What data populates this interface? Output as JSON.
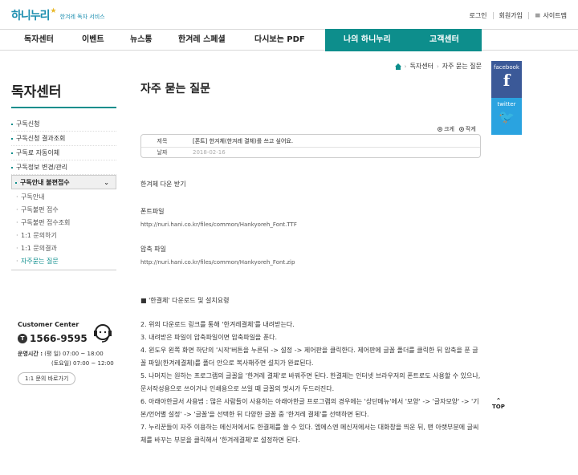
{
  "header": {
    "logo_text": "하니누리",
    "logo_sub": "한겨레 독자 서비스",
    "util": {
      "login": "로그인",
      "join": "회원가입",
      "sitemap": "사이트맵"
    }
  },
  "nav": {
    "items": [
      "독자센터",
      "이벤트",
      "뉴스통",
      "한겨레 스페셜",
      "다시보는 PDF"
    ],
    "highlight": [
      "나의 하니누리",
      "고객센터"
    ]
  },
  "breadcrumb": [
    "독자센터",
    "자주 묻는 질문"
  ],
  "social": {
    "facebook": "facebook",
    "twitter": "twitter"
  },
  "sidebar": {
    "title": "독자센터",
    "items": [
      "구독신청",
      "구독신청 결과조회",
      "구독료 자동이체",
      "구독정보 변경/관리"
    ],
    "open_item": "구독안내 불편접수",
    "sub_items": [
      "구독안내",
      "구독불편 접수",
      "구독불편 접수조회",
      "1:1 문의하기",
      "1:1 문의결과",
      "자주묻는 질문"
    ]
  },
  "customer_center": {
    "title": "Customer Center",
    "phone": "1566-9595",
    "hours_label": "운영시간 :",
    "hours_weekday": "(평    일) 07:00 ~ 18:00",
    "hours_sat": "(토요일) 07:00 ~ 12:00",
    "button": "1:1 문의 바로가기"
  },
  "article": {
    "page_title": "자주 묻는 질문",
    "font_bigger": "크게",
    "font_smaller": "작게",
    "subject_label": "제목",
    "subject": "[폰트] 한겨체(한겨레 결체)를 쓰고 싶어요.",
    "date_label": "날짜",
    "date": "2018-02-16",
    "lines": {
      "l1": "한겨체 다운 받기",
      "l2": "폰트파일",
      "l3": "http://nuri.hani.co.kr/files/common/Hankyoreh_Font.TTF",
      "l4": "압축 파일",
      "l5": "http://nuri.hani.co.kr/files/common/Hankyoreh_Font.zip",
      "l6": "■ '한결체' 다운로드 및 설치요령",
      "l7": "2. 위의 다운로드 링크를 통해 '한겨레결체'를 내려받는다.",
      "l8": "3. 내려받은 파일이 압축파일이면 압축파일을 푼다.",
      "l9": "4. 윈도우 왼쪽 화면 하단의 '시작'버튼을 누른뒤 -> 설정 -> 제어판을 클릭한다. 제어판에 글꼴 폴더를 클릭한 뒤 압축을 푼 글꼴 파일(한겨레결체)를 폴더 안으로 복사해주면 설치가 완료된다.",
      "l10": "5. 나머지는 원하는 프로그램의 글꼴을 '한겨레 결체'로 바꿔주면 된다. 한결체는 인터넷 브라우저의 폰트로도 사용할 수 있으나, 문서작성용으로 쓰이거나 인쇄용으로 쓰일 때 글꼴의 멋시가 두드러진다.",
      "l11": "6. 아래아한글서 사용법 : 많은 사람들이 사용하는 아래아한글 프로그램의 경우에는 '상단메뉴'에서 '모양' -> '글자모양' -> '기본/언어별 설정' -> '글꼴'을 선택한 뒤 다양한 글꼴 중 '한겨레 결체'를 선택하면 된다.",
      "l12": "7. 누리꾼들이 자주 이용하는 메신저에서도 한결체를 쓸 수 있다. 엠에스엔 메신저에서는 대화창을 띄운 뒤, 맨 아랫부분에 글씨체를 바꾸는 부분을 클릭해서 '한겨레결체'로 설정하면 된다."
    },
    "top": "TOP"
  }
}
